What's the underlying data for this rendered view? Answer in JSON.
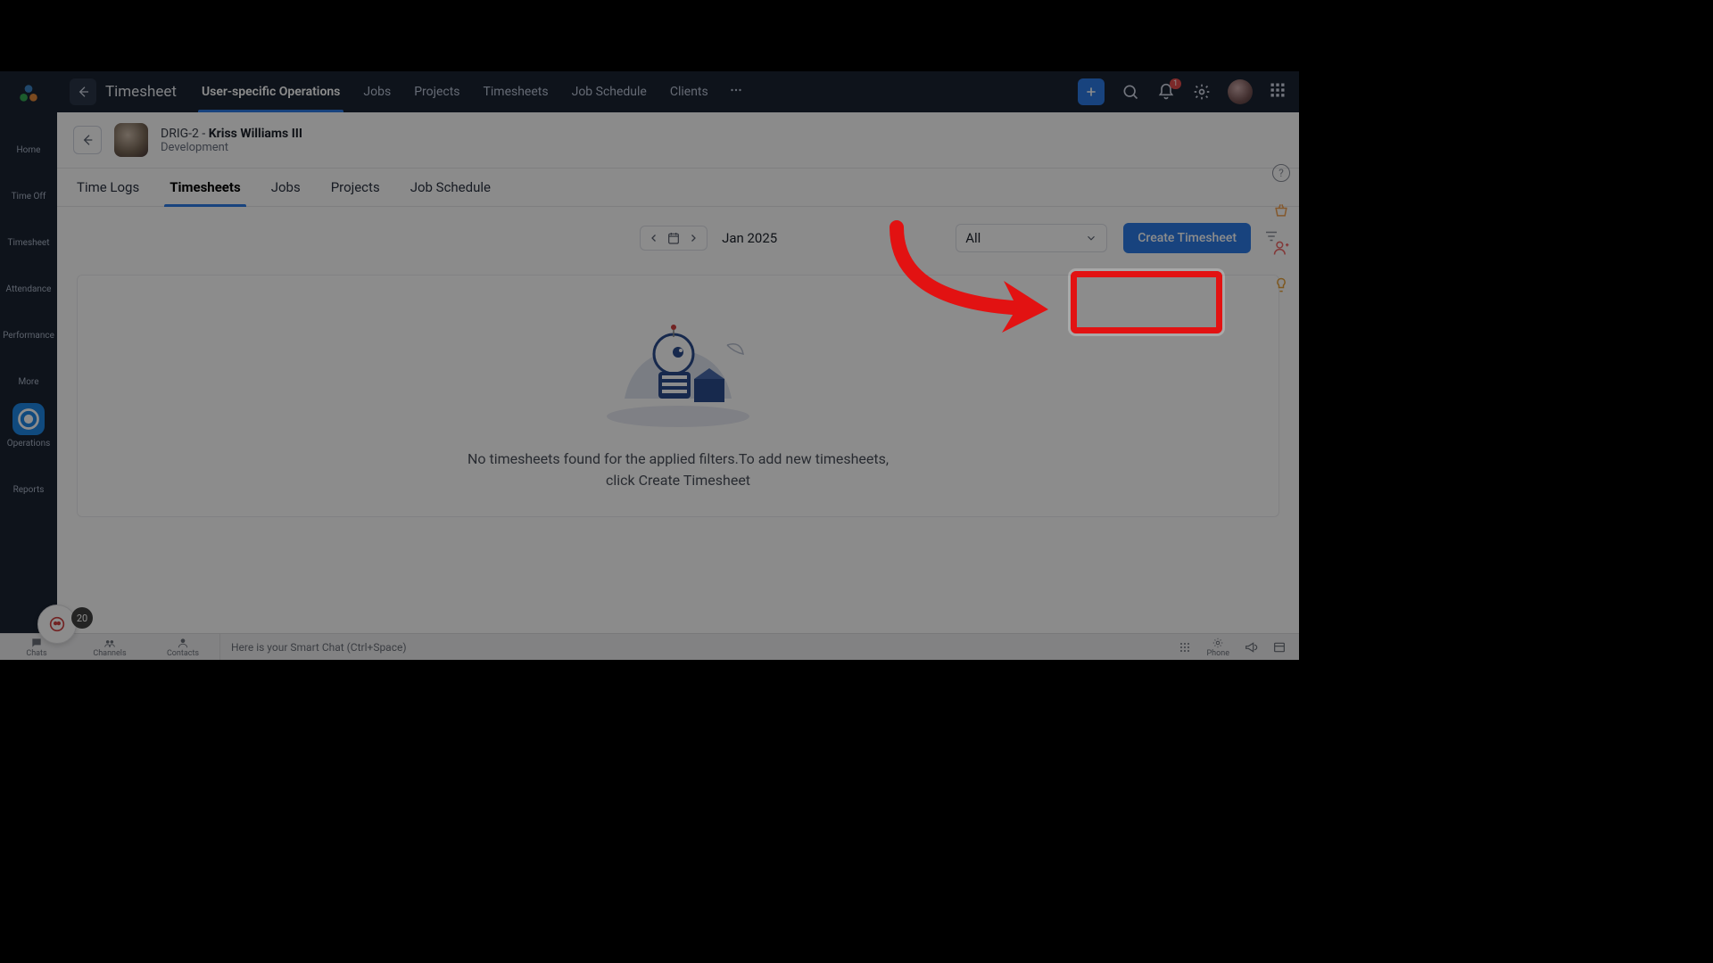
{
  "topbar": {
    "title": "Timesheet",
    "tabs": [
      "User-specific Operations",
      "Jobs",
      "Projects",
      "Timesheets",
      "Job Schedule",
      "Clients"
    ],
    "active_tab_index": 0,
    "notification_count": "1"
  },
  "leftnav": {
    "items": [
      {
        "label": "Home"
      },
      {
        "label": "Time Off"
      },
      {
        "label": "Timesheet"
      },
      {
        "label": "Attendance"
      },
      {
        "label": "Performance"
      },
      {
        "label": "More"
      },
      {
        "label": "Operations"
      },
      {
        "label": "Reports"
      }
    ],
    "active_index": 6
  },
  "user_header": {
    "code": "DRIG-2",
    "name": "Kriss Williams III",
    "department": "Development"
  },
  "subtabs": {
    "items": [
      "Time Logs",
      "Timesheets",
      "Jobs",
      "Projects",
      "Job Schedule"
    ],
    "active_index": 1
  },
  "controls": {
    "date_label": "Jan 2025",
    "filter_value": "All",
    "create_button": "Create Timesheet"
  },
  "empty_state": {
    "line1": "No timesheets found for the applied filters.To add new timesheets,",
    "line2": "click Create Timesheet"
  },
  "bottombar": {
    "items": [
      "Chats",
      "Channels",
      "Contacts"
    ],
    "smartchat_placeholder": "Here is your Smart Chat (Ctrl+Space)",
    "badge": "20",
    "phone_label": "Phone"
  }
}
